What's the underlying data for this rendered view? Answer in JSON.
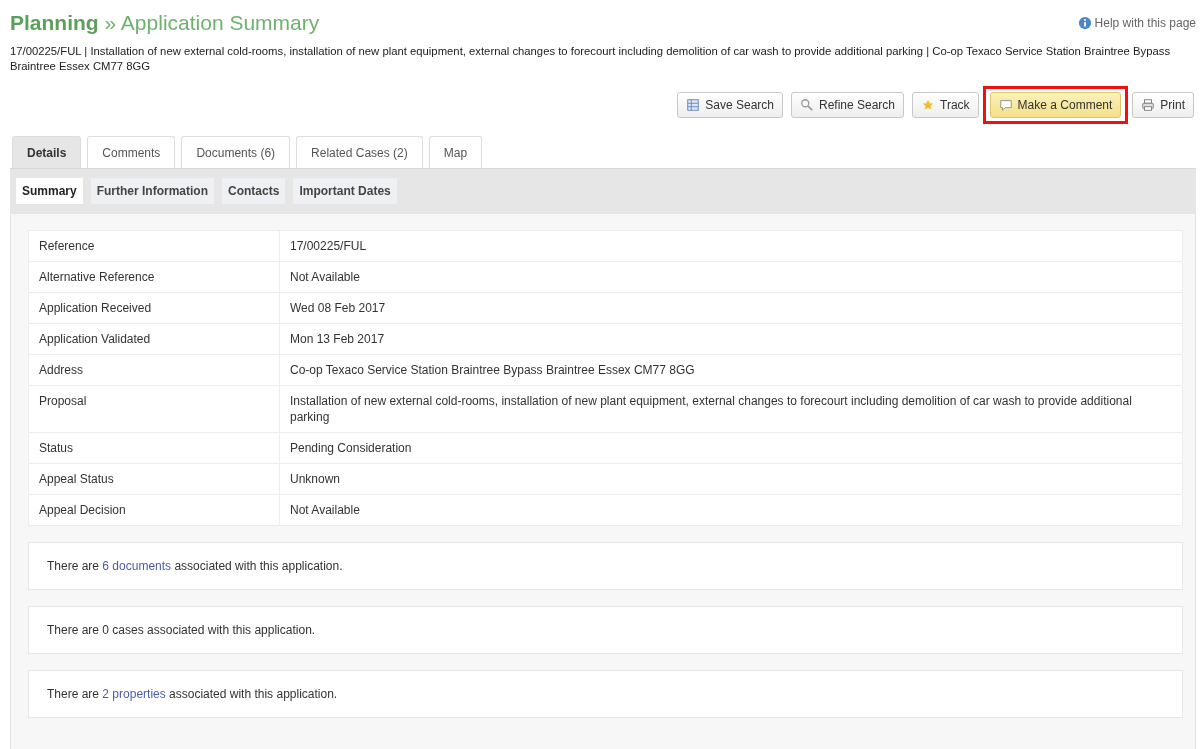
{
  "header": {
    "section": "Planning",
    "separator": "»",
    "title": "Application Summary",
    "help": "Help with this page"
  },
  "description": "17/00225/FUL | Installation of new external cold-rooms, installation of new plant equipment, external changes to forecourt including demolition of car wash to provide additional parking | Co-op Texaco Service Station Braintree Bypass Braintree Essex CM77 8GG",
  "buttons": [
    {
      "label": "Save Search",
      "kind": "save",
      "highlighted": false
    },
    {
      "label": "Refine Search",
      "kind": "refine",
      "highlighted": false
    },
    {
      "label": "Track",
      "kind": "track",
      "highlighted": false
    },
    {
      "label": "Make a Comment",
      "kind": "comment",
      "highlighted": true
    },
    {
      "label": "Print",
      "kind": "print",
      "highlighted": false
    }
  ],
  "tabs": [
    {
      "label": "Details",
      "selected": true
    },
    {
      "label": "Comments",
      "selected": false
    },
    {
      "label": "Documents (6)",
      "selected": false
    },
    {
      "label": "Related Cases (2)",
      "selected": false
    },
    {
      "label": "Map",
      "selected": false
    }
  ],
  "subtabs": [
    {
      "label": "Summary",
      "selected": true
    },
    {
      "label": "Further Information",
      "selected": false
    },
    {
      "label": "Contacts",
      "selected": false
    },
    {
      "label": "Important Dates",
      "selected": false
    }
  ],
  "table": {
    "rows": [
      {
        "label": "Reference",
        "value": "17/00225/FUL"
      },
      {
        "label": "Alternative Reference",
        "value": "Not Available"
      },
      {
        "label": "Application Received",
        "value": "Wed 08 Feb 2017"
      },
      {
        "label": "Application Validated",
        "value": "Mon 13 Feb 2017"
      },
      {
        "label": "Address",
        "value": "Co-op Texaco Service Station Braintree Bypass Braintree Essex CM77 8GG"
      },
      {
        "label": "Proposal",
        "value": "Installation of new external cold-rooms, installation of new plant equipment, external changes to forecourt including demolition of car wash to provide additional parking"
      },
      {
        "label": "Status",
        "value": "Pending Consideration"
      },
      {
        "label": "Appeal Status",
        "value": "Unknown"
      },
      {
        "label": "Appeal Decision",
        "value": "Not Available"
      }
    ]
  },
  "notes": [
    {
      "kind": "link",
      "before": "There are",
      "link": "6 documents",
      "after": "associated with this application."
    },
    {
      "kind": "plain",
      "text": "There are 0 cases associated with this application."
    },
    {
      "kind": "link",
      "before": "There are",
      "link": "2 properties",
      "after": "associated with this application."
    }
  ]
}
